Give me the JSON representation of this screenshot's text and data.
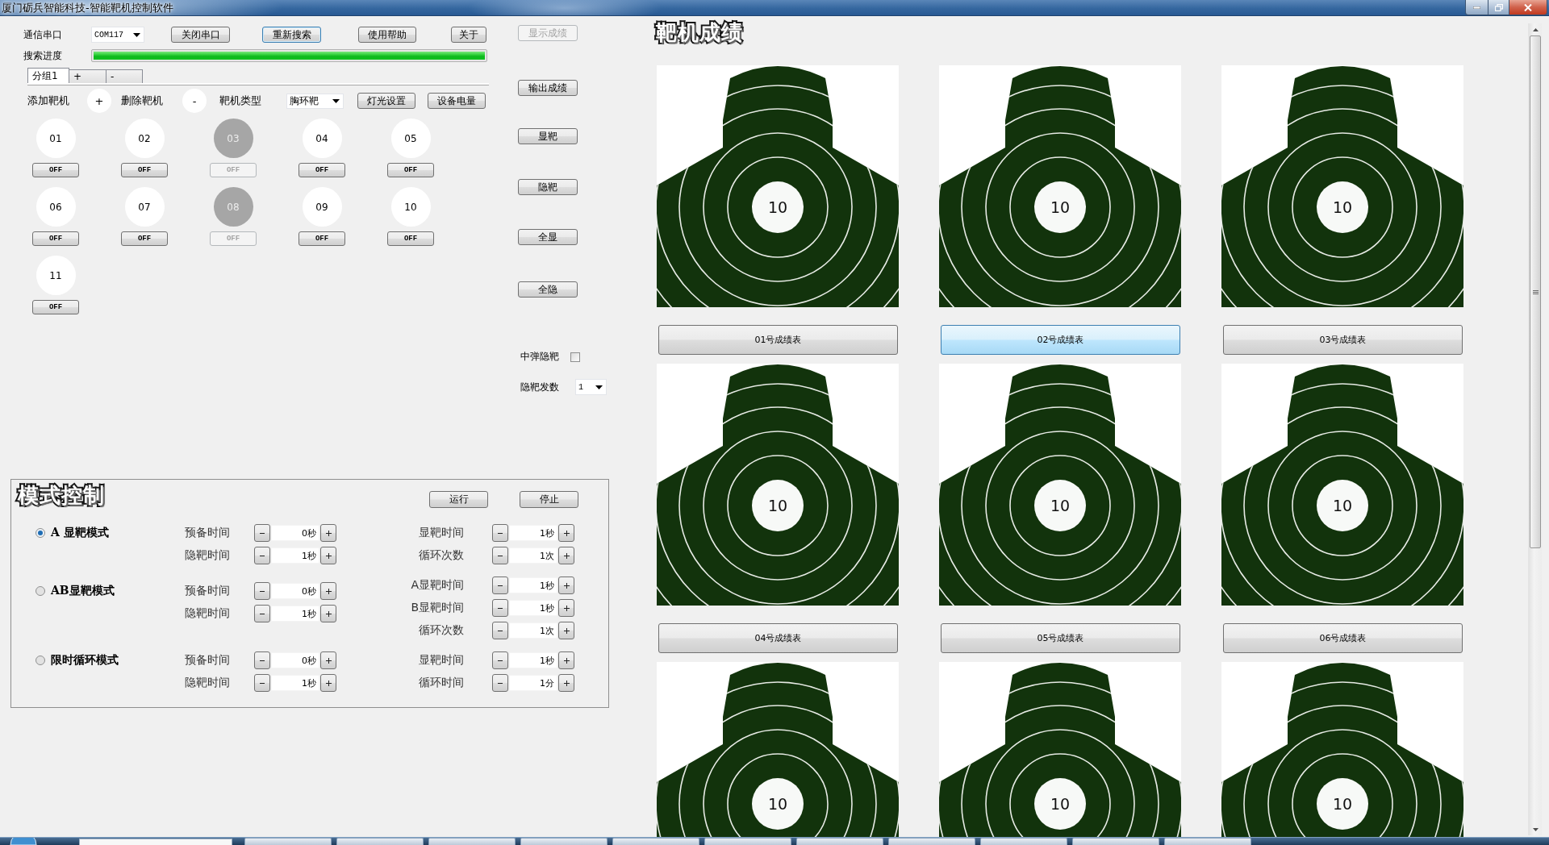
{
  "window": {
    "title": "厦门砺兵智能科技-智能靶机控制软件"
  },
  "connection": {
    "port_label": "通信串口",
    "port": "COM117",
    "buttons": [
      {
        "label": "关闭串口",
        "focused": false
      },
      {
        "label": "重新搜索",
        "focused": true
      },
      {
        "label": "使用帮助",
        "focused": false
      },
      {
        "label": "关于",
        "focused": false
      }
    ],
    "progress": {
      "label": "搜索进度",
      "level": 1
    }
  },
  "group_tabs": [
    {
      "label": "分组1",
      "selected": true
    },
    {
      "label": "+",
      "selected": false
    },
    {
      "label": "-",
      "selected": false
    }
  ],
  "target_tools": {
    "add_label": "添加靶机",
    "add_button": "+",
    "remove_label": "删除靶机",
    "remove_button": "-",
    "type_label": "靶机类型",
    "type_value": "胸环靶",
    "buttons": [
      "灯光设置",
      "设备电量"
    ]
  },
  "target_units": [
    {
      "number": "01",
      "online": true,
      "switch": "OFF"
    },
    {
      "number": "02",
      "online": true,
      "switch": "OFF"
    },
    {
      "number": "03",
      "online": false,
      "switch": "OFF"
    },
    {
      "number": "04",
      "online": true,
      "switch": "OFF"
    },
    {
      "number": "05",
      "online": true,
      "switch": "OFF"
    },
    {
      "number": "06",
      "online": true,
      "switch": "OFF"
    },
    {
      "number": "07",
      "online": true,
      "switch": "OFF"
    },
    {
      "number": "08",
      "online": false,
      "switch": "OFF"
    },
    {
      "number": "09",
      "online": true,
      "switch": "OFF"
    },
    {
      "number": "10",
      "online": true,
      "switch": "OFF"
    },
    {
      "number": "11",
      "online": true,
      "switch": "OFF"
    }
  ],
  "side_panel": {
    "buttons": [
      {
        "label": "显示成绩",
        "disabled": true
      },
      {
        "label": "输出成绩",
        "disabled": false
      },
      {
        "label": "显靶",
        "disabled": false
      },
      {
        "label": "隐靶",
        "disabled": false
      },
      {
        "label": "全显",
        "disabled": false
      },
      {
        "label": "全隐",
        "disabled": false
      }
    ],
    "hide_on_hit": {
      "label": "中弹隐靶",
      "checked": false
    },
    "hide_count": {
      "label": "隐靶发数",
      "value": "1"
    }
  },
  "mode_control": {
    "title": "模式控制",
    "buttons": [
      "运行",
      "停止"
    ],
    "modes": [
      {
        "label": "A 显靶模式",
        "selected": true,
        "left_fields": [
          {
            "label": "预备时间",
            "value": "0秒"
          },
          {
            "label": "隐靶时间",
            "value": "1秒"
          }
        ],
        "right_fields": [
          {
            "label": "显靶时间",
            "value": "1秒"
          },
          {
            "label": "循环次数",
            "value": "1次"
          }
        ]
      },
      {
        "label": "AB显靶模式",
        "selected": false,
        "left_fields": [
          {
            "label": "预备时间",
            "value": "0秒"
          },
          {
            "label": "隐靶时间",
            "value": "1秒"
          }
        ],
        "right_fields": [
          {
            "label": "A显靶时间",
            "value": "1秒"
          },
          {
            "label": "B显靶时间",
            "value": "1秒"
          },
          {
            "label": "循环次数",
            "value": "1次"
          }
        ]
      },
      {
        "label": "限时循环模式",
        "selected": false,
        "left_fields": [
          {
            "label": "预备时间",
            "value": "0秒"
          },
          {
            "label": "隐靶时间",
            "value": "1秒"
          }
        ],
        "right_fields": [
          {
            "label": "显靶时间",
            "value": "1秒"
          },
          {
            "label": "循环时间",
            "value": "1分"
          }
        ]
      }
    ]
  },
  "scores": {
    "title": "靶机成绩",
    "targets": [
      {
        "score": "10",
        "sheet": {
          "label": "01号成绩表",
          "selected": false
        }
      },
      {
        "score": "10",
        "sheet": {
          "label": "02号成绩表",
          "selected": true
        }
      },
      {
        "score": "10",
        "sheet": {
          "label": "03号成绩表",
          "selected": false
        }
      },
      {
        "score": "10",
        "sheet": {
          "label": "04号成绩表",
          "selected": false
        }
      },
      {
        "score": "10",
        "sheet": {
          "label": "05号成绩表",
          "selected": false
        }
      },
      {
        "score": "10",
        "sheet": {
          "label": "06号成绩表",
          "selected": false
        }
      },
      {
        "score": "10"
      },
      {
        "score": "10"
      },
      {
        "score": "10"
      }
    ]
  }
}
